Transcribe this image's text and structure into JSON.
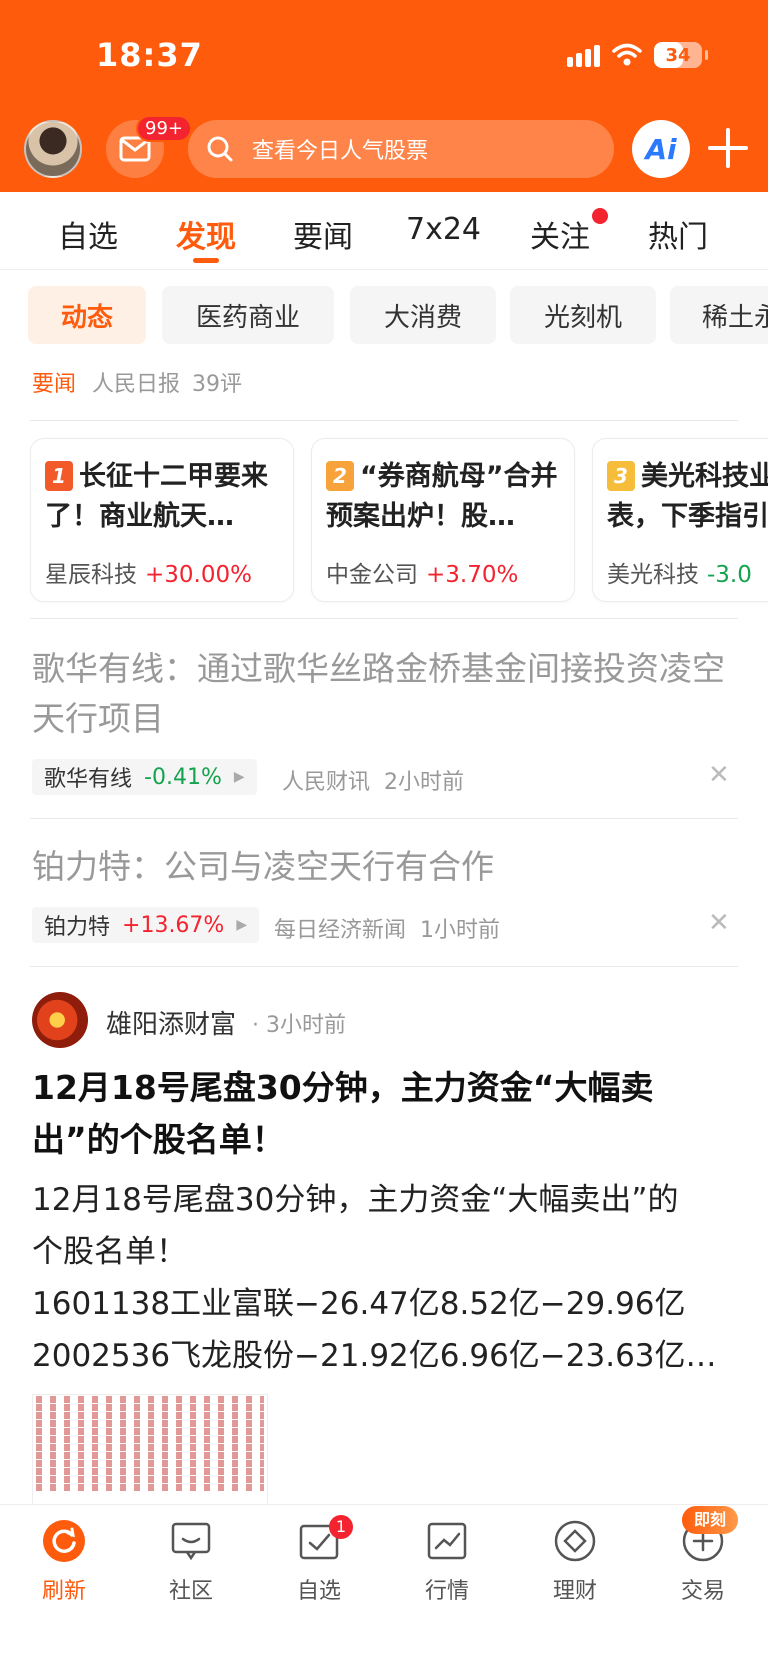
{
  "status_bar": {
    "time": "18:37",
    "battery": "34"
  },
  "header": {
    "mail_badge": "99+",
    "search_placeholder": "查看今日人气股票",
    "ai_label": "Ai"
  },
  "tabs": [
    {
      "label": "自选",
      "active": false
    },
    {
      "label": "发现",
      "active": true
    },
    {
      "label": "要闻",
      "active": false
    },
    {
      "label": "7x24",
      "active": false
    },
    {
      "label": "关注",
      "active": false,
      "dot": true
    },
    {
      "label": "热门",
      "active": false
    }
  ],
  "chips": [
    {
      "label": "动态",
      "active": true
    },
    {
      "label": "医药商业"
    },
    {
      "label": "大消费"
    },
    {
      "label": "光刻机"
    },
    {
      "label": "稀土永"
    }
  ],
  "headline_meta": {
    "tag": "要闻",
    "source": "人民日报",
    "comments": "39评"
  },
  "cards": [
    {
      "rank": "1",
      "rank_color": "#f25a2a",
      "title": "长征十二甲要来了！商业航天…",
      "stock": "星辰科技",
      "change": "+30.00%",
      "direction": "up"
    },
    {
      "rank": "2",
      "rank_color": "#f7a23b",
      "title": "“券商航母”合并预案出炉！股…",
      "stock": "中金公司",
      "change": "+3.70%",
      "direction": "up"
    },
    {
      "rank": "3",
      "rank_color": "#f6bd3a",
      "title": "美光科技业绩爆表，下季指引",
      "stock": "美光科技",
      "change": "-3.0",
      "direction": "down"
    }
  ],
  "news": [
    {
      "title": "歌华有线：通过歌华丝路金桥基金间接投资凌空天行项目",
      "stock": "歌华有线",
      "change": "-0.41%",
      "direction": "down",
      "source": "人民财讯",
      "time": "2小时前"
    },
    {
      "title": "铂力特：公司与凌空天行有合作",
      "stock": "铂力特",
      "change": "+13.67%",
      "direction": "up",
      "source": "每日经济新闻",
      "time": "1小时前"
    }
  ],
  "post": {
    "author": "雄阳添财富",
    "time": "· 3小时前",
    "title": "12月18号尾盘30分钟，主力资金“大幅卖出”的个股名单！",
    "body_lines": [
      "12月18号尾盘30分钟，主力资金“大幅卖出”的",
      "个股名单！",
      "1601138工业富联−26.47亿8.52亿−29.96亿",
      "2002536飞龙股份−21.92亿6.96亿−23.63亿…"
    ]
  },
  "bottom_nav": [
    {
      "label": "刷新",
      "icon": "refresh-icon",
      "active": true
    },
    {
      "label": "社区",
      "icon": "chat-icon"
    },
    {
      "label": "自选",
      "icon": "checklist-icon",
      "badge": "1"
    },
    {
      "label": "行情",
      "icon": "trend-chart-icon"
    },
    {
      "label": "理财",
      "icon": "diamond-icon"
    },
    {
      "label": "交易",
      "icon": "plus-circle-icon",
      "tag": "即刻"
    }
  ],
  "close_symbol": "✕",
  "colors": {
    "brand": "#fe5b0d",
    "up": "#f3232f",
    "down": "#14a44d"
  }
}
